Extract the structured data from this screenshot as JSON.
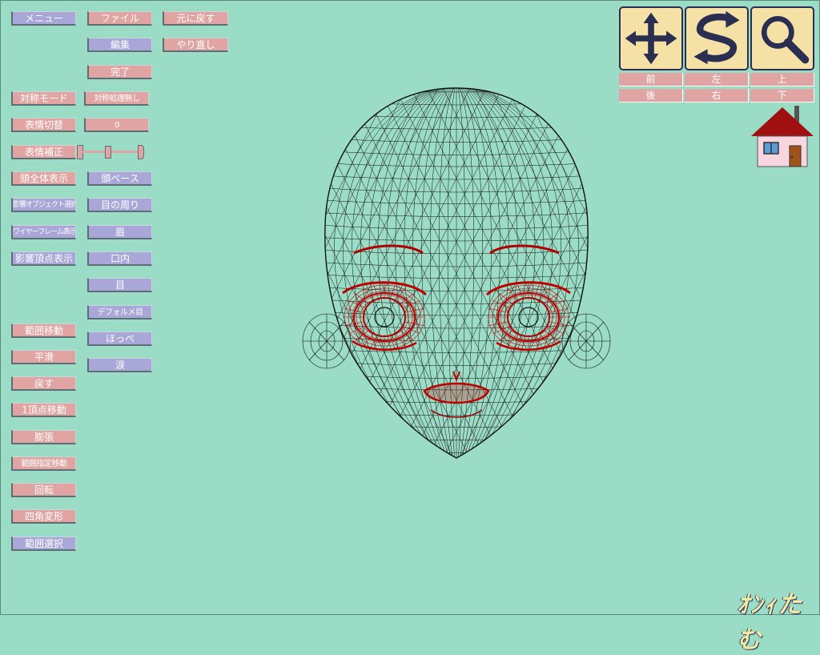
{
  "menu": {
    "menu": "メニュー",
    "file": "ファイル",
    "undo": "元に戻す",
    "edit": "編集",
    "redo": "やり直し",
    "done": "完了"
  },
  "left": {
    "symmetry_mode": "対称モード",
    "symmetry_off": "対称処理無し",
    "expression_switch": "表情切替",
    "expression_value": "0",
    "expression_correct": "表情補正",
    "show_whole_head": "頭全体表示",
    "influence_object_select": "影響オブジェクト選択",
    "wireframe_show": "ワイヤーフレーム表示",
    "influence_vertex_show": "影響頂点表示",
    "range_move": "範囲移動",
    "smooth": "平滑",
    "revert": "戻す",
    "one_vertex_move": "1頂点移動",
    "inflate": "膨張",
    "range_specified_move": "範囲指定移動",
    "rotate": "回転",
    "quad_transform": "四角変形",
    "range_select": "範囲選択"
  },
  "parts": {
    "head_base": "頭ベース",
    "around_eyes": "目の周り",
    "eyebrow": "眉",
    "mouth_inside": "口内",
    "eye": "目",
    "deformed_eye": "デフォルメ目",
    "cheek": "ほっぺ",
    "tears": "涙"
  },
  "slider": {
    "value": 0.45
  },
  "view": {
    "tools": [
      "move-icon",
      "rotate-icon",
      "zoom-icon"
    ],
    "front": "前",
    "left": "左",
    "top": "上",
    "back": "後",
    "right": "右",
    "bottom": "下"
  },
  "logo": {
    "text": "ｵﾝｨたむ"
  },
  "colors": {
    "background": "#9bdcc6",
    "pink_button": "#e0a4a2",
    "purple_button": "#a9a6d8",
    "tool_face": "#f5e1a6",
    "tool_icon": "#2a2f52",
    "wire": "#111111",
    "wire_highlight": "#c00000"
  }
}
